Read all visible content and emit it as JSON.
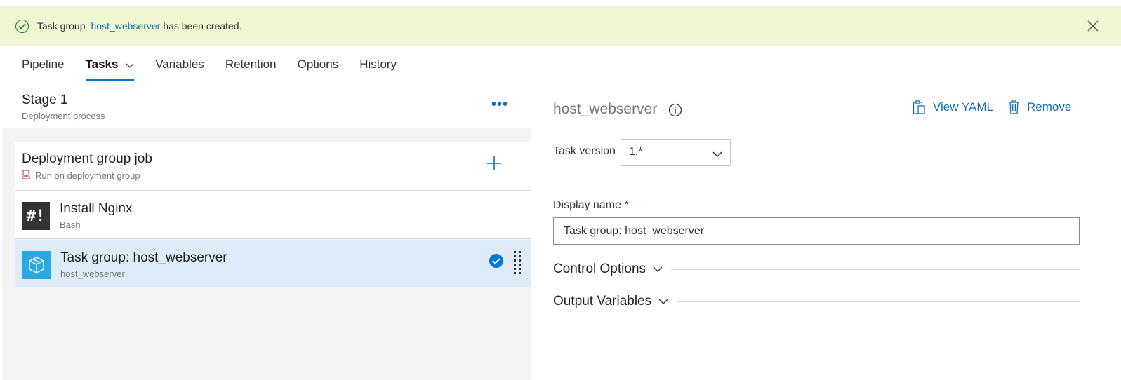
{
  "banner": {
    "prefix": "Task group",
    "link": "host_webserver",
    "suffix": "has been created."
  },
  "tabs": [
    {
      "label": "Pipeline"
    },
    {
      "label": "Tasks"
    },
    {
      "label": "Variables"
    },
    {
      "label": "Retention"
    },
    {
      "label": "Options"
    },
    {
      "label": "History"
    }
  ],
  "stage": {
    "title": "Stage 1",
    "subtitle": "Deployment process"
  },
  "job": {
    "title": "Deployment group job",
    "subtitle": "Run on deployment group"
  },
  "tasks": [
    {
      "title": "Install Nginx",
      "subtitle": "Bash",
      "icon": "bash-icon",
      "icon_text": "#!"
    },
    {
      "title": "Task group: host_webserver",
      "subtitle": "host_webserver",
      "icon": "task-group-icon",
      "selected": true
    }
  ],
  "details": {
    "title": "host_webserver",
    "view_yaml": "View YAML",
    "remove": "Remove",
    "task_version_label": "Task version",
    "task_version_value": "1.*",
    "display_name_label": "Display name",
    "required_marker": "*",
    "display_name_value": "Task group: host_webserver",
    "sections": [
      {
        "label": "Control Options"
      },
      {
        "label": "Output Variables"
      }
    ]
  },
  "colors": {
    "accent": "#0078d4",
    "link": "#106ebe",
    "banner_bg": "#eff6d2",
    "success": "#107c10",
    "selected_bg": "#deecf9"
  }
}
